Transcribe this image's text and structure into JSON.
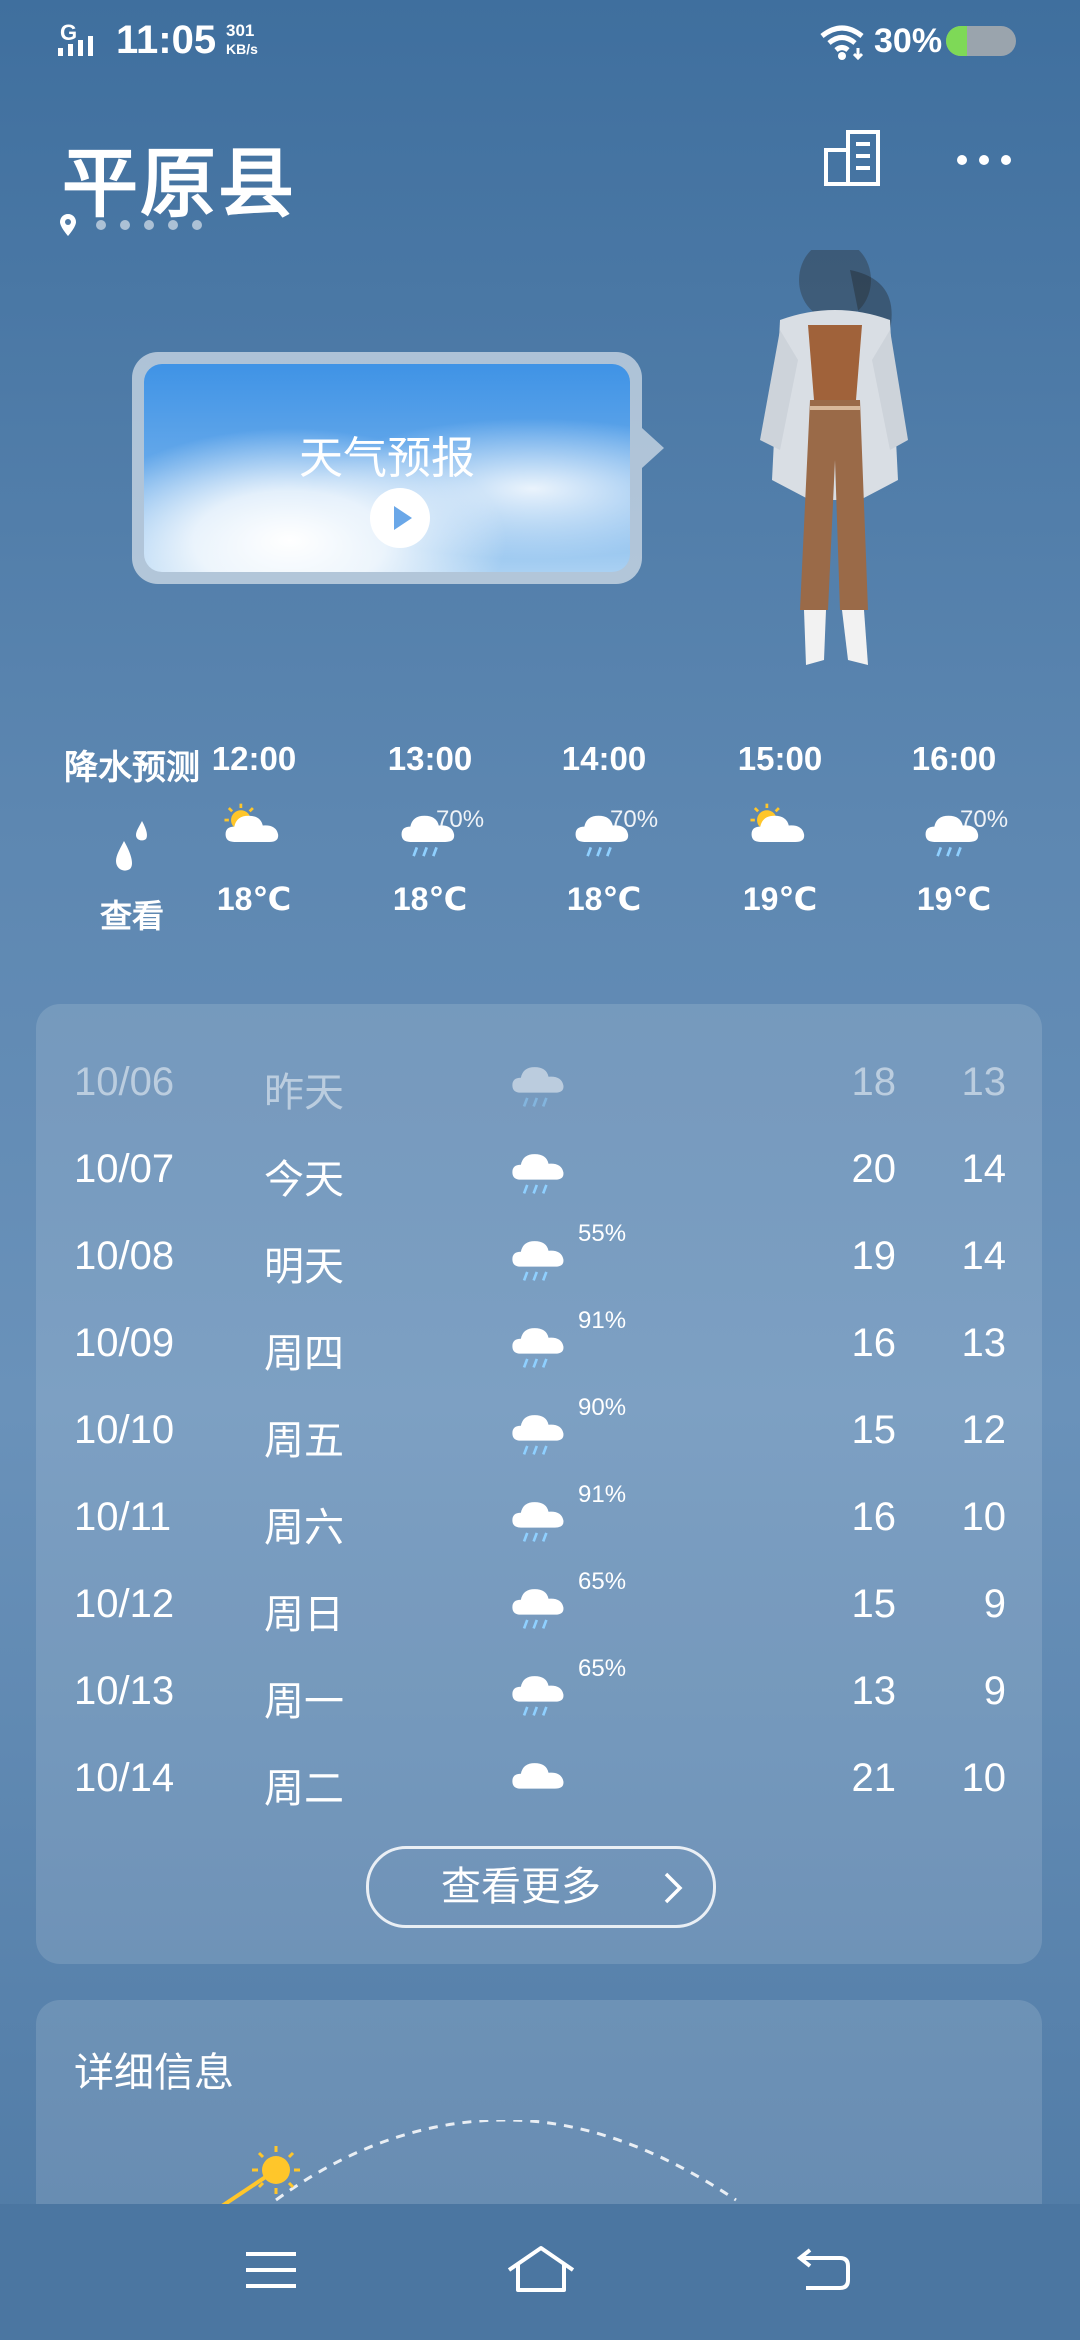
{
  "status": {
    "network": "G",
    "time": "11:05",
    "speed_value": "301",
    "speed_unit": "KB/s",
    "battery": "30%",
    "battery_level": 0.3
  },
  "location": {
    "city": "平原县"
  },
  "video_card": {
    "title": "天气预报",
    "play_icon": "play-icon"
  },
  "precip": {
    "label": "降水预测",
    "action": "查看",
    "icon": "raindrops-icon"
  },
  "hourly": [
    {
      "time": "12:00",
      "icon": "sun-cloud-icon",
      "pct": "",
      "temp": "18℃"
    },
    {
      "time": "13:00",
      "icon": "rain-cloud-icon",
      "pct": "70%",
      "temp": "18℃"
    },
    {
      "time": "14:00",
      "icon": "rain-cloud-icon",
      "pct": "70%",
      "temp": "18℃"
    },
    {
      "time": "15:00",
      "icon": "sun-cloud-icon",
      "pct": "",
      "temp": "19℃"
    },
    {
      "time": "16:00",
      "icon": "rain-cloud-icon",
      "pct": "70%",
      "temp": "19℃"
    }
  ],
  "daily": [
    {
      "date": "10/06",
      "day": "昨天",
      "icon": "rain-cloud-icon",
      "pct": "",
      "high": "18",
      "low": "13",
      "dim": true
    },
    {
      "date": "10/07",
      "day": "今天",
      "icon": "rain-cloud-icon",
      "pct": "",
      "high": "20",
      "low": "14"
    },
    {
      "date": "10/08",
      "day": "明天",
      "icon": "rain-cloud-icon",
      "pct": "55%",
      "high": "19",
      "low": "14"
    },
    {
      "date": "10/09",
      "day": "周四",
      "icon": "rain-cloud-icon",
      "pct": "91%",
      "high": "16",
      "low": "13"
    },
    {
      "date": "10/10",
      "day": "周五",
      "icon": "rain-cloud-icon",
      "pct": "90%",
      "high": "15",
      "low": "12"
    },
    {
      "date": "10/11",
      "day": "周六",
      "icon": "rain-cloud-icon",
      "pct": "91%",
      "high": "16",
      "low": "10"
    },
    {
      "date": "10/12",
      "day": "周日",
      "icon": "rain-cloud-icon",
      "pct": "65%",
      "high": "15",
      "low": "9"
    },
    {
      "date": "10/13",
      "day": "周一",
      "icon": "rain-cloud-icon",
      "pct": "65%",
      "high": "13",
      "low": "9"
    },
    {
      "date": "10/14",
      "day": "周二",
      "icon": "cloud-icon",
      "pct": "",
      "high": "21",
      "low": "10"
    }
  ],
  "more_button": "查看更多",
  "detail": {
    "label": "详细信息"
  },
  "colors": {
    "background_top": "#3f6f9e",
    "background_mid": "#6a92ba",
    "sun": "#ffc62a"
  }
}
